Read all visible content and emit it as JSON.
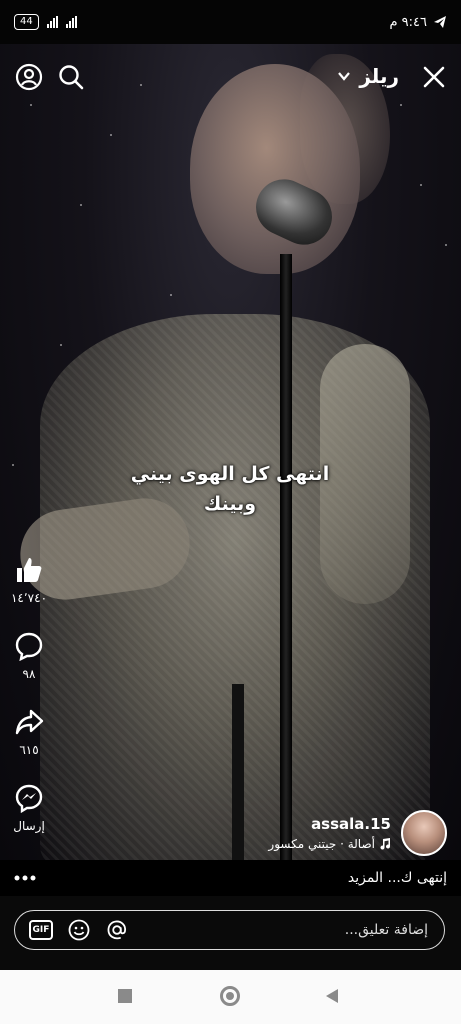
{
  "status_bar": {
    "battery": "44",
    "time": "٩:٤٦ م"
  },
  "header": {
    "title": "ريلز"
  },
  "lyric": {
    "line1": "انتهى كل الهوى بيني",
    "line2": "وبينك"
  },
  "actions": {
    "like_count": "١٤٬٧٤٠",
    "comment_count": "٩٨",
    "share_count": "٦١٥",
    "send_label": "إرسال"
  },
  "author": {
    "name": "assala.15",
    "music": "أصالة · جيتني مكسور"
  },
  "caption": {
    "text": "إنتهى ك... المزيد"
  },
  "comment": {
    "placeholder": "إضافة تعليق...",
    "gif_label": "GIF"
  },
  "icons": {
    "close": "close-icon",
    "dropdown": "chevron-down-icon",
    "search": "search-icon",
    "profile": "profile-icon",
    "like": "thumbs-up-icon",
    "comment": "comment-icon",
    "share": "share-icon",
    "messenger": "messenger-icon",
    "more": "more-dots-icon",
    "music": "music-note-icon",
    "emoji": "emoji-icon",
    "mention": "at-icon"
  }
}
